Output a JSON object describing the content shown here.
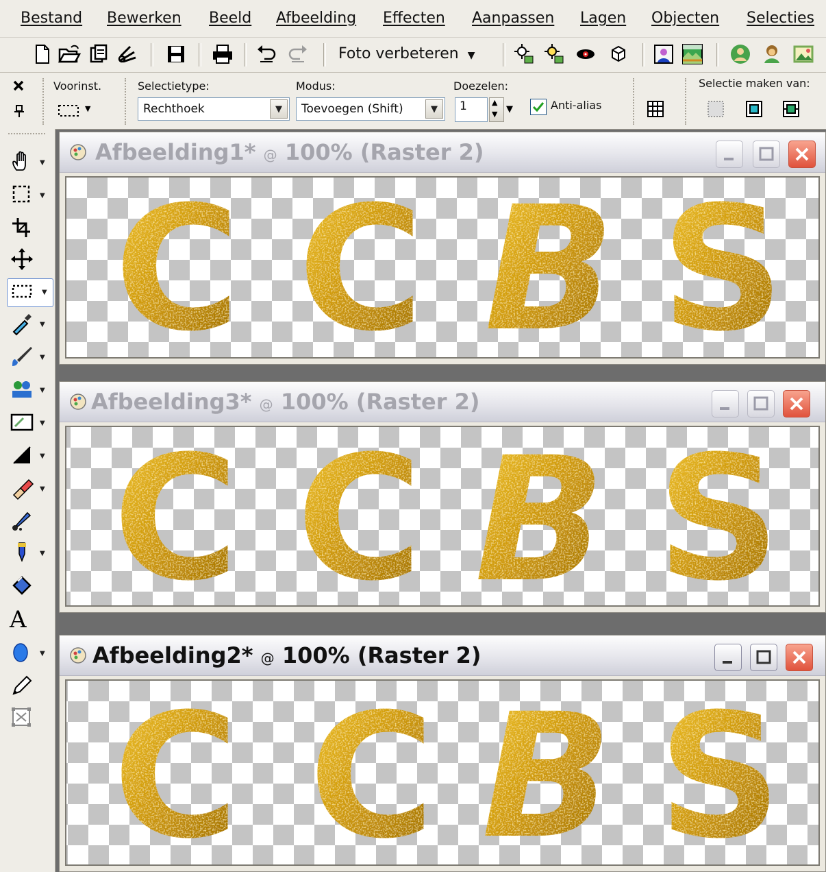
{
  "menu": [
    "Bestand",
    "Bewerken",
    "Beeld",
    "Afbeelding",
    "Effecten",
    "Aanpassen",
    "Lagen",
    "Objecten",
    "Selecties"
  ],
  "toolbar": {
    "foto_verbeteren": "Foto verbeteren",
    "icons": [
      "new-icon",
      "open-icon",
      "browse-icon",
      "scan-icon",
      "save-icon",
      "print-icon",
      "undo-icon",
      "redo-icon",
      "enhance-icon",
      "enhance2-icon",
      "red-eye-icon",
      "cube-icon",
      "portrait-icon",
      "landscape-icon",
      "person-icon",
      "person2-icon",
      "picture-icon"
    ]
  },
  "options": {
    "voorinst_label": "Voorinst.",
    "selectietype_label": "Selectietype:",
    "selectietype_value": "Rechthoek",
    "modus_label": "Modus:",
    "modus_value": "Toevoegen (Shift)",
    "doezelen_label": "Doezelen:",
    "doezelen_value": "1",
    "anti_alias_label": "Anti-alias",
    "anti_alias_checked": true,
    "selectie_maken_label": "Selectie maken van:"
  },
  "tools": [
    "pan-icon",
    "selection-icon",
    "crop-icon",
    "move-icon",
    "rect-select-icon",
    "dropper-icon",
    "paint-brush-icon",
    "clone-icon",
    "scratch-remover-icon",
    "dodge-icon",
    "eraser-icon",
    "picture-tube-icon",
    "flood-fill-icon",
    "pen-fill-icon",
    "text-icon",
    "ellipse-icon",
    "pen-icon",
    "deform-icon"
  ],
  "windows": [
    {
      "name": "Afbeelding1*",
      "zoom": "100% (Raster 2)",
      "active": false,
      "letters": [
        "C",
        "C",
        "B",
        "S"
      ]
    },
    {
      "name": "Afbeelding3*",
      "zoom": "100% (Raster 2)",
      "active": false,
      "letters": [
        "C",
        "C",
        "B",
        "S"
      ]
    },
    {
      "name": "Afbeelding2*",
      "zoom": "100% (Raster 2)",
      "active": true,
      "letters": [
        "C",
        "C",
        "B",
        "S"
      ]
    }
  ],
  "colors": {
    "gold_light": "#f3c734",
    "gold_mid": "#d09b0a",
    "gold_dark": "#8d5d02",
    "checker": "#c4c4c4"
  }
}
